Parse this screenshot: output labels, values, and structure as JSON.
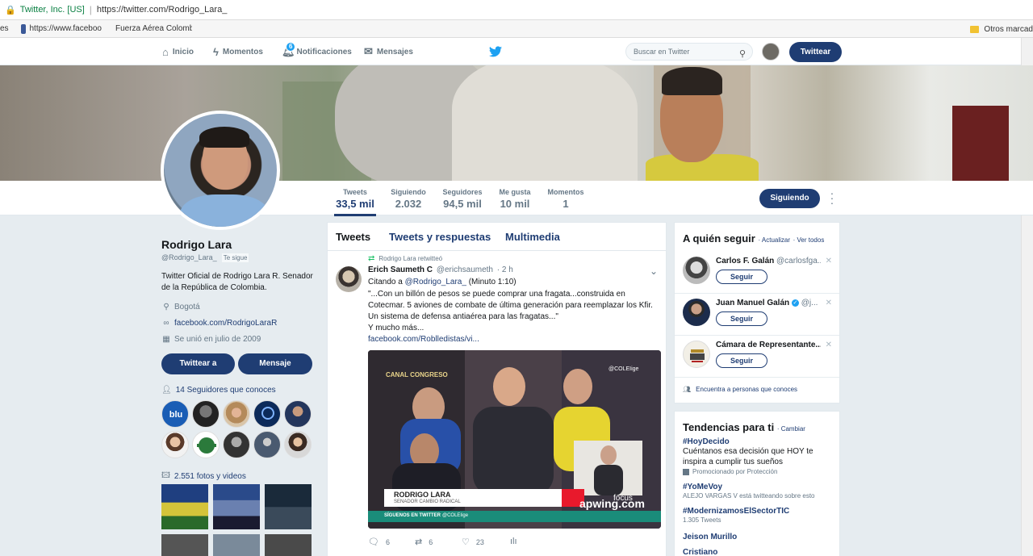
{
  "browser": {
    "site_identity": "Twitter, Inc. [US]",
    "url": "https://twitter.com/Rodrigo_Lara_",
    "bookmarks": [
      {
        "label": "es"
      },
      {
        "label": "https://www.faceboo"
      },
      {
        "label": "Fuerza Aérea Colomb"
      }
    ],
    "other_bookmarks": "Otros marcad"
  },
  "nav": {
    "home": "Inicio",
    "moments": "Momentos",
    "notifications": "Notificaciones",
    "notifications_count": "6",
    "messages": "Mensajes",
    "search_placeholder": "Buscar en Twitter",
    "tweet_button": "Twittear"
  },
  "profile": {
    "name": "Rodrigo Lara",
    "handle": "@Rodrigo_Lara_",
    "follows_you": "Te sigue",
    "bio": "Twitter Oficial de Rodrigo Lara R. Senador de la República de Colombia.",
    "location": "Bogotá",
    "website": "facebook.com/RodrigoLaraR",
    "joined": "Se unió en julio de 2009",
    "tweet_to": "Twittear a",
    "message": "Mensaje",
    "followers_you_know": "14 Seguidores que conoces",
    "photos_videos": "2.551 fotos y videos"
  },
  "stats": [
    {
      "label": "Tweets",
      "value": "33,5 mil"
    },
    {
      "label": "Siguiendo",
      "value": "2.032"
    },
    {
      "label": "Seguidores",
      "value": "94,5 mil"
    },
    {
      "label": "Me gusta",
      "value": "10 mil"
    },
    {
      "label": "Momentos",
      "value": "1"
    }
  ],
  "following_button": "Siguiendo",
  "timeline": {
    "tabs": [
      "Tweets",
      "Tweets y respuestas",
      "Multimedia"
    ],
    "tweet": {
      "retweet_note": "Rodrigo Lara retwitteó",
      "author_name": "Erich Saumeth C",
      "author_handle": "@erichsaumeth",
      "time": "· 2 h",
      "cite_prefix": "Citando a",
      "cite_mention": "@Rodrigo_Lara_",
      "cite_suffix": "(Minuto 1:10)",
      "body": "\"...Con un billón de pesos se puede comprar una fragata...construida en Cotecmar. 5 aviones de combate de última generación para reemplazar los Kfir. Un sistema de defensa antiaérea para las fragatas...\"",
      "body2": "Y mucho más...",
      "link": "facebook.com/Roblledistas/vi...",
      "media": {
        "channel": "CANAL CONGRESO",
        "handle_overlay": "@COLEIige",
        "lower_third_name": "RODRIGO LARA",
        "lower_third_role": "SENADOR CAMBIO RADICAL",
        "ticker": "SÍGUENOS EN TWITTER",
        "ticker_handle": "@COLEIige",
        "watermark": "apwing.com",
        "focus": "focus"
      },
      "replies": "6",
      "retweets": "6",
      "likes": "23"
    }
  },
  "who_to_follow": {
    "title": "A quién seguir",
    "refresh": "· Actualizar",
    "view_all": "· Ver todos",
    "follow_label": "Seguir",
    "items": [
      {
        "name": "Carlos F. Galán",
        "handle": "@carlosfga..."
      },
      {
        "name": "Juan Manuel Galán",
        "handle": "@j..."
      },
      {
        "name": "Cámara de Representante...",
        "handle": ""
      }
    ],
    "find_people": "Encuentra a personas que conoces"
  },
  "trends": {
    "title": "Tendencias para ti",
    "change": "· Cambiar",
    "items": [
      {
        "tag": "#HoyDecido",
        "desc": "Cuéntanos esa decisión que HOY te inspira a cumplir tus sueños",
        "sub": "Promocionado por Protección"
      },
      {
        "tag": "#YoMeVoy",
        "desc": "",
        "sub": "ALEJO VARGAS V está twitteando sobre esto"
      },
      {
        "tag": "#ModernizamosElSectorTIC",
        "desc": "",
        "sub": "1.305 Tweets"
      },
      {
        "tag": "Jeison Murillo",
        "desc": "",
        "sub": ""
      },
      {
        "tag": "Cristiano",
        "desc": "",
        "sub": ""
      }
    ]
  },
  "colors": {
    "primary": "#1f3d73",
    "twitter_blue": "#1da1f2",
    "background": "#e6ecf0"
  }
}
